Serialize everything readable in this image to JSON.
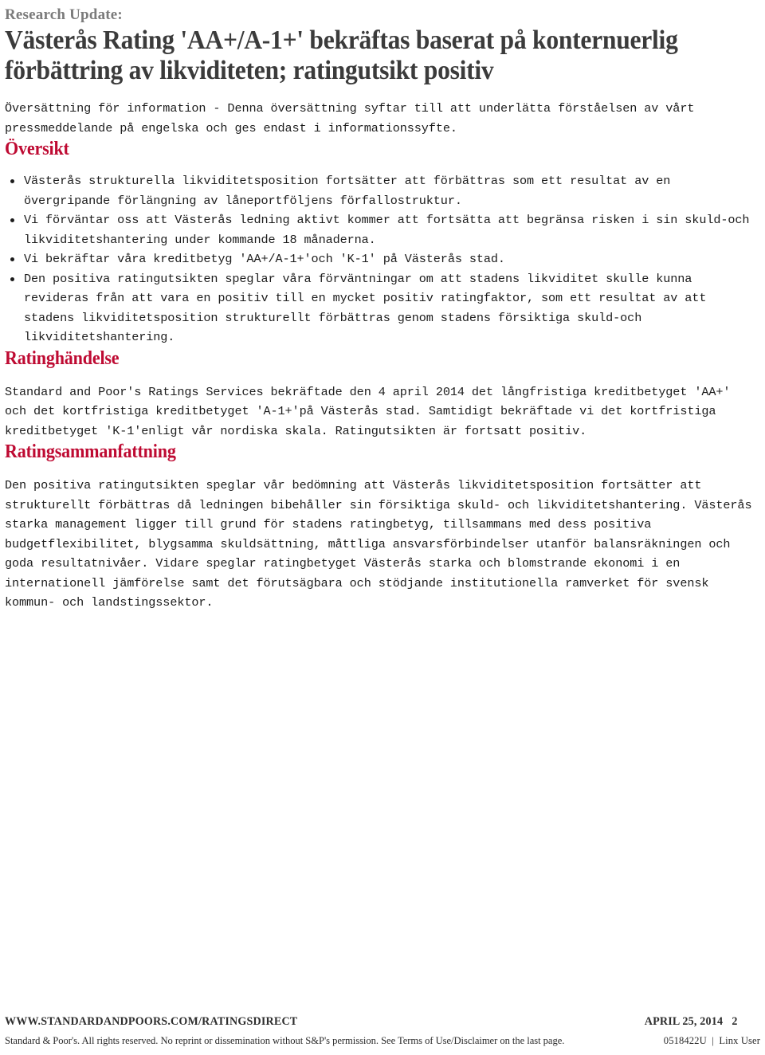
{
  "header": {
    "kicker": "Research Update:",
    "title": "Västerås Rating 'AA+/A-1+' bekräftas baserat på konternuerlig förbättring av likviditeten; ratingutsikt positiv"
  },
  "intro": "Översättning för information - Denna översättning syftar till att underlätta förståelsen av vårt pressmeddelande på engelska och ges endast i informationssyfte.",
  "sections": {
    "overview": {
      "heading": "Översikt",
      "bullets": [
        "Västerås strukturella likviditetsposition fortsätter att förbättras som ett resultat av en övergripande förlängning av låneportföljens förfallostruktur.",
        "Vi förväntar oss att Västerås ledning aktivt kommer att fortsätta att begränsa risken i sin skuld-och likviditetshantering under kommande 18 månaderna.",
        "Vi bekräftar våra kreditbetyg 'AA+/A-1+'och 'K-1' på Västerås stad.",
        "Den positiva ratingutsikten speglar våra förväntningar om att stadens likviditet skulle kunna revideras från att vara en positiv till en mycket positiv ratingfaktor, som ett resultat av att stadens likviditetsposition strukturellt förbättras genom stadens försiktiga skuld-och likviditetshantering."
      ]
    },
    "event": {
      "heading": "Ratinghändelse",
      "body": "Standard and Poor's Ratings Services bekräftade den 4 april 2014 det långfristiga kreditbetyget 'AA+' och det kortfristiga kreditbetyget 'A-1+'på Västerås stad. Samtidigt bekräftade vi det kortfristiga kreditbetyget 'K-1'enligt vår nordiska skala. Ratingutsikten är fortsatt positiv."
    },
    "summary": {
      "heading": "Ratingsammanfattning",
      "body": "Den positiva ratingutsikten speglar vår bedömning att Västerås likviditetsposition fortsätter att strukturellt förbättras då ledningen bibehåller sin försiktiga skuld- och likviditetshantering. Västerås starka management ligger till grund för stadens ratingbetyg, tillsammans med dess positiva budgetflexibilitet, blygsamma skuldsättning, måttliga ansvarsförbindelser utanför balansräkningen och goda resultatnivåer. Vidare speglar ratingbetyget Västerås starka och blomstrande ekonomi i en internationell jämförelse samt det förutsägbara och stödjande institutionella ramverket för svensk kommun- och landstingssektor."
    }
  },
  "footer": {
    "site": "WWW.STANDARDANDPOORS.COM/RATINGSDIRECT",
    "date": "APRIL 25, 2014   2",
    "legal": "Standard & Poor's. All rights reserved. No reprint or dissemination without S&P's permission. See Terms of Use/Disclaimer on the last page.",
    "doc_id": "0518422U  |  Linx User"
  },
  "colors": {
    "accent": "#be0a32",
    "kicker": "#7b7b7b",
    "title": "#3b3b3b",
    "body": "#1c1c1c"
  }
}
